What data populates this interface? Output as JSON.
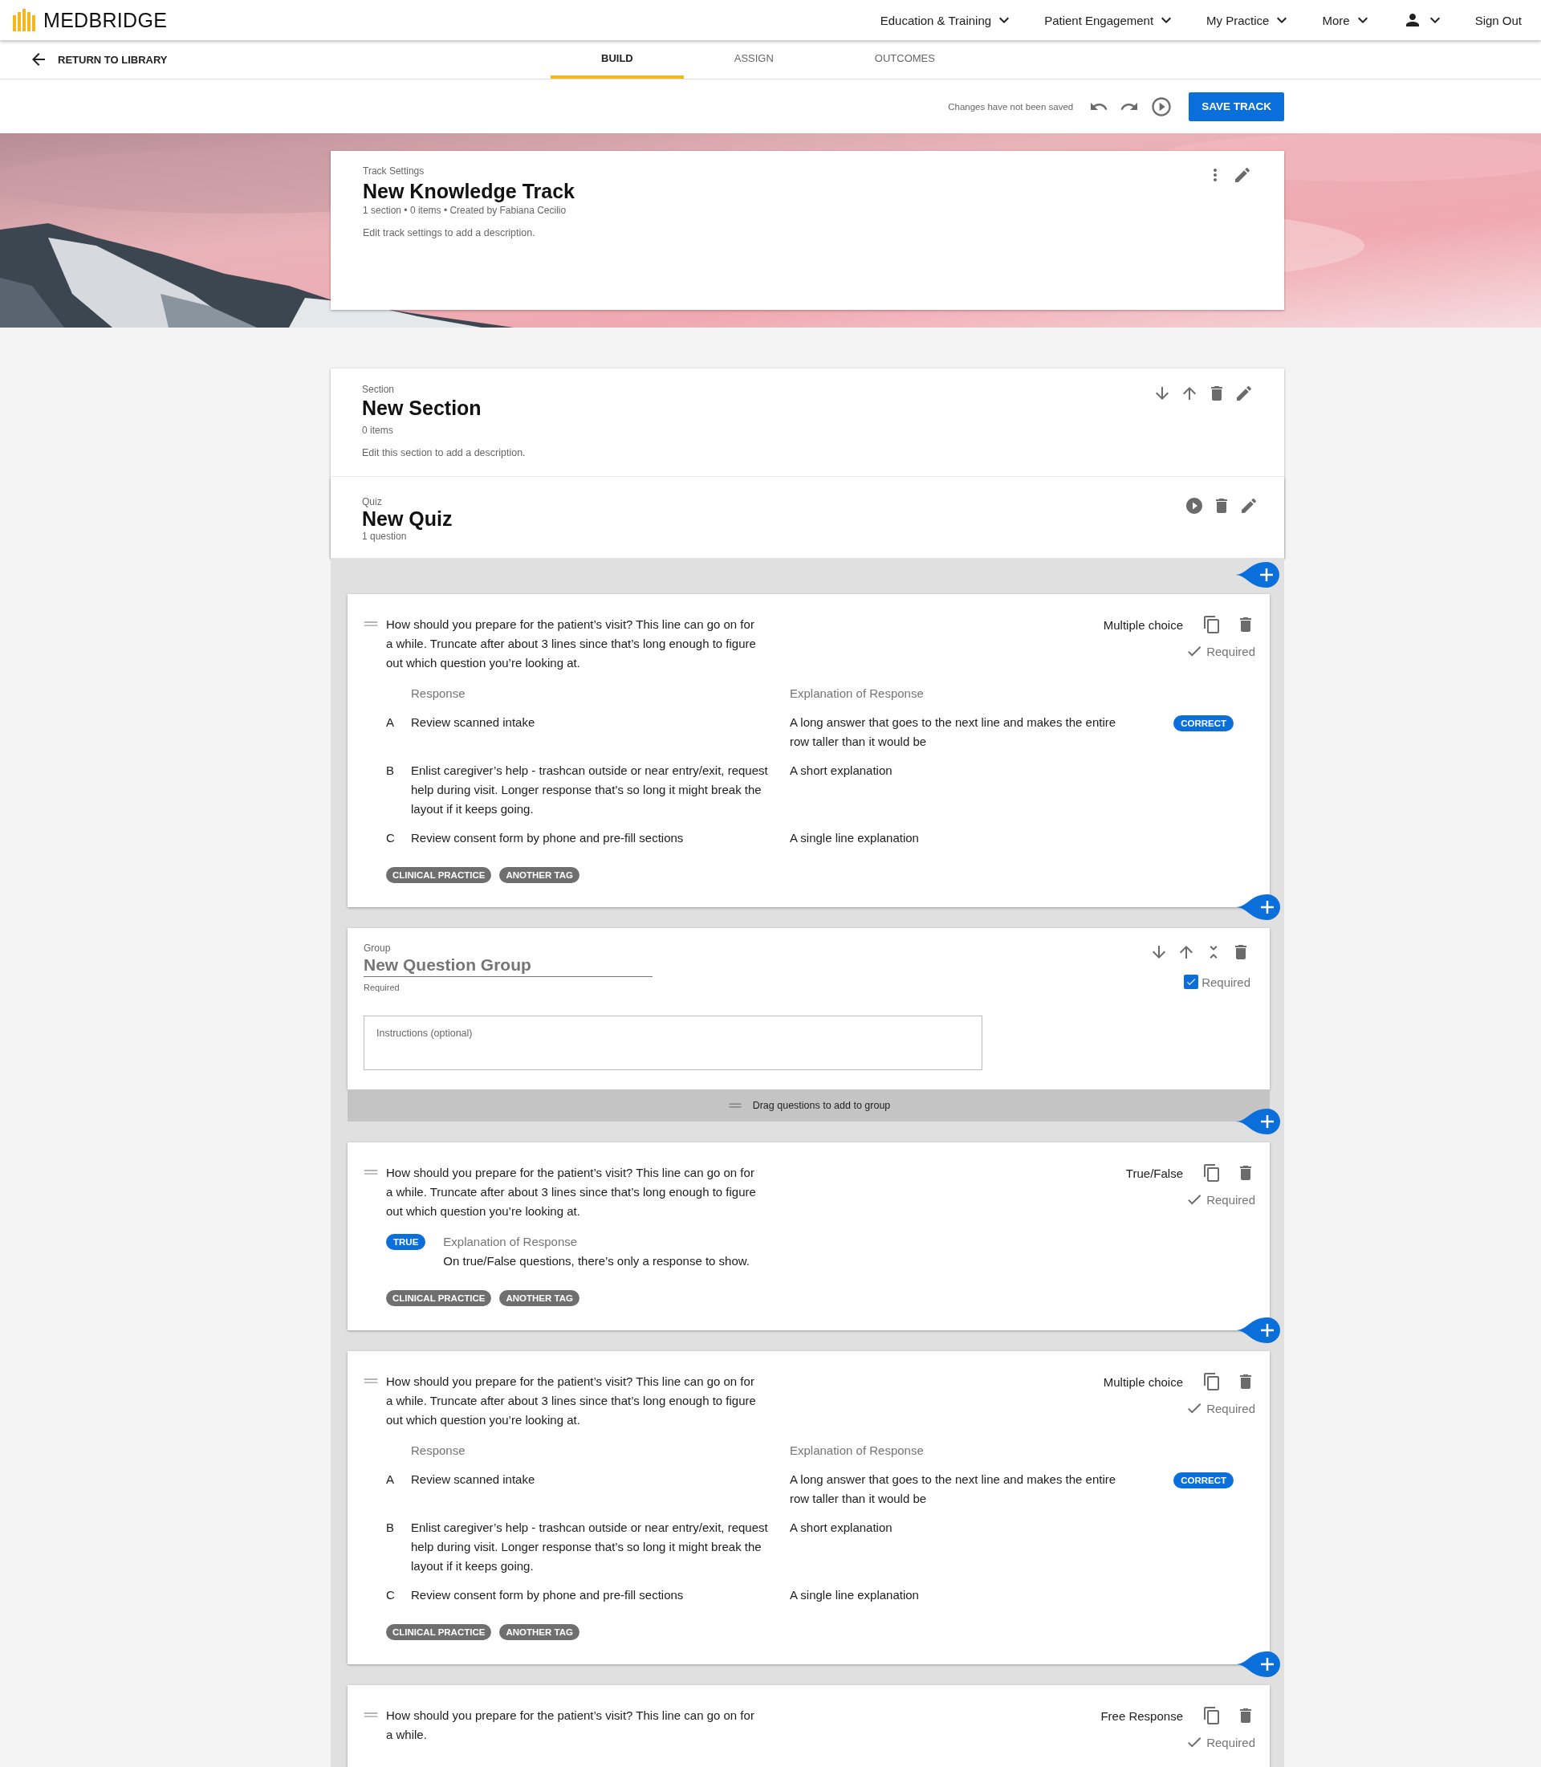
{
  "header": {
    "brand": "MEDBRIDGE",
    "nav": [
      {
        "label": "Education & Training"
      },
      {
        "label": "Patient Engagement"
      },
      {
        "label": "My Practice"
      },
      {
        "label": "More"
      }
    ],
    "sign_out": "Sign Out"
  },
  "subnav": {
    "back": "RETURN TO LIBRARY",
    "tabs": [
      {
        "label": "BUILD",
        "selected": true
      },
      {
        "label": "ASSIGN",
        "selected": false
      },
      {
        "label": "OUTCOMES",
        "selected": false
      }
    ]
  },
  "toolbar": {
    "status": "Changes have not been saved",
    "save": "SAVE TRACK"
  },
  "track": {
    "label": "Track Settings",
    "title": "New Knowledge Track",
    "meta": "1 section  • 0 items  •  Created by Fabiana Cecilio",
    "description": "Edit track settings to add a description."
  },
  "section": {
    "label": "Section",
    "title": "New Section",
    "count": "0 items",
    "description": "Edit this section to add a description."
  },
  "quiz": {
    "label": "Quiz",
    "title": "New Quiz",
    "count": "1 question"
  },
  "items": [
    {
      "kind": "multiple_choice",
      "question": "How should you prepare for the patient’s visit? This line can go on for a while. Truncate after about 3 lines since that’s long enough to figure out which question you’re looking at.",
      "type_label": "Multiple choice",
      "required": true,
      "required_label": "Required",
      "response_header": "Response",
      "explanation_header": "Explanation of Response",
      "correct_label": "CORRECT",
      "options": [
        {
          "letter": "A",
          "response": "Review scanned intake",
          "explanation": "A long answer that goes to the next line and makes the entire row taller than it would be",
          "correct": true
        },
        {
          "letter": "B",
          "response": "Enlist caregiver’s help - trashcan outside or near entry/exit, request help during visit. Longer response that’s so long it might break the layout if it keeps going.",
          "explanation": "A short explanation",
          "correct": false
        },
        {
          "letter": "C",
          "response": "Review consent form by phone and pre-fill sections",
          "explanation": "A single line explanation",
          "correct": false
        }
      ],
      "tags": [
        "CLINICAL PRACTICE",
        "ANOTHER TAG"
      ]
    },
    {
      "kind": "group",
      "label": "Group",
      "title": "New Question Group",
      "sublabel": "Required",
      "required": true,
      "required_label": "Required",
      "instructions_placeholder": "Instructions (optional)",
      "drop_hint": "Drag questions to add to group"
    },
    {
      "kind": "true_false",
      "question": "How should you prepare for the patient’s visit? This line can go on for a while. Truncate after about 3 lines since that’s long enough to figure out which question you’re looking at.",
      "type_label": "True/False",
      "required": true,
      "required_label": "Required",
      "answer": "TRUE",
      "explanation_header": "Explanation of Response",
      "explanation": "On true/False questions, there’s only a response to show.",
      "tags": [
        "CLINICAL PRACTICE",
        "ANOTHER TAG"
      ]
    },
    {
      "kind": "multiple_choice",
      "question": "How should you prepare for the patient’s visit? This line can go on for a while. Truncate after about 3 lines since that’s long enough to figure out which question you’re looking at.",
      "type_label": "Multiple choice",
      "required": true,
      "required_label": "Required",
      "response_header": "Response",
      "explanation_header": "Explanation of Response",
      "correct_label": "CORRECT",
      "options": [
        {
          "letter": "A",
          "response": "Review scanned intake",
          "explanation": "A long answer that goes to the next line and makes the entire row taller than it would be",
          "correct": true
        },
        {
          "letter": "B",
          "response": "Enlist caregiver’s help - trashcan outside or near entry/exit, request help during visit. Longer response that’s so long it might break the layout if it keeps going.",
          "explanation": "A short explanation",
          "correct": false
        },
        {
          "letter": "C",
          "response": "Review consent form by phone and pre-fill sections",
          "explanation": "A single line explanation",
          "correct": false
        }
      ],
      "tags": [
        "CLINICAL PRACTICE",
        "ANOTHER TAG"
      ]
    },
    {
      "kind": "free_response",
      "question": "How should you prepare for the patient’s visit? This line can go on for a while.",
      "type_label": "Free Response",
      "required": true,
      "required_label": "Required"
    }
  ]
}
